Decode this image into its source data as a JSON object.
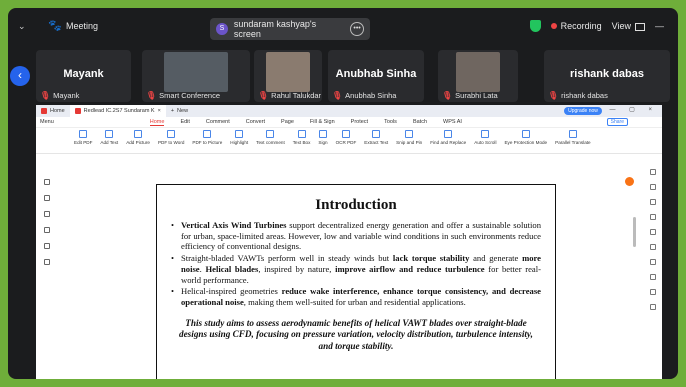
{
  "topbar": {
    "meeting_label": "Meeting",
    "share_initial": "S",
    "share_label": "sundaram kashyap's screen",
    "recording_label": "Recording",
    "view_label": "View"
  },
  "participants": [
    {
      "big": "Mayank",
      "name": "Mayank"
    },
    {
      "big": "",
      "name": "Smart Conference"
    },
    {
      "big": "",
      "name": "Rahul Talukdar"
    },
    {
      "big": "Anubhab Sinha",
      "name": "Anubhab Sinha"
    },
    {
      "big": "",
      "name": "Surabhi Lata"
    },
    {
      "big": "rishank dabas",
      "name": "rishank dabas"
    }
  ],
  "browser": {
    "tab_home": "Home",
    "tab_doc": "Redlead IC.2S7 Sundaram K",
    "tab_new": "New",
    "upgrade": "Upgrade now",
    "menu": [
      "Menu",
      "Home",
      "Edit",
      "Comment",
      "Convert",
      "Page",
      "Fill & Sign",
      "Protect",
      "Tools",
      "Batch",
      "WPS AI"
    ],
    "share": "Share",
    "ribbon": [
      "Edit PDF",
      "Add Text",
      "Add Picture",
      "PDF to Word",
      "PDF to Picture",
      "Highlight",
      "Text comment",
      "Text Box",
      "Sign",
      "OCR PDF",
      "Extract Text",
      "Snip and Pin",
      "Find and Replace",
      "Auto Scroll",
      "Eye Protection Mode",
      "Parallel Translate"
    ]
  },
  "doc": {
    "title": "Introduction",
    "b1_pre": "",
    "b1_bold": "Vertical Axis Wind Turbines",
    "b1_rest": " support decentralized energy generation and offer a sustainable solution for urban, space-limited areas. However, low and variable wind conditions in such environments reduce efficiency of conventional designs.",
    "b2_a": "Straight-bladed VAWTs perform well in steady winds but ",
    "b2_b1": "lack torque stability",
    "b2_c": " and generate ",
    "b2_b2": "more noise",
    "b2_d": ". ",
    "b2_b3": "Helical blades",
    "b2_e": ", inspired by nature, ",
    "b2_b4": "improve airflow and reduce turbulence",
    "b2_f": " for better real-world performance.",
    "b3_a": "Helical-inspired geometries ",
    "b3_b1": "reduce wake interference, enhance torque consistency, and decrease operational noise",
    "b3_c": ", making them well-suited for urban and residential applications.",
    "conclusion": "This study aims to assess aerodynamic benefits of helical VAWT blades over straight-blade designs using CFD, focusing on pressure variation, velocity distribution, turbulence intensity, and torque stability."
  }
}
